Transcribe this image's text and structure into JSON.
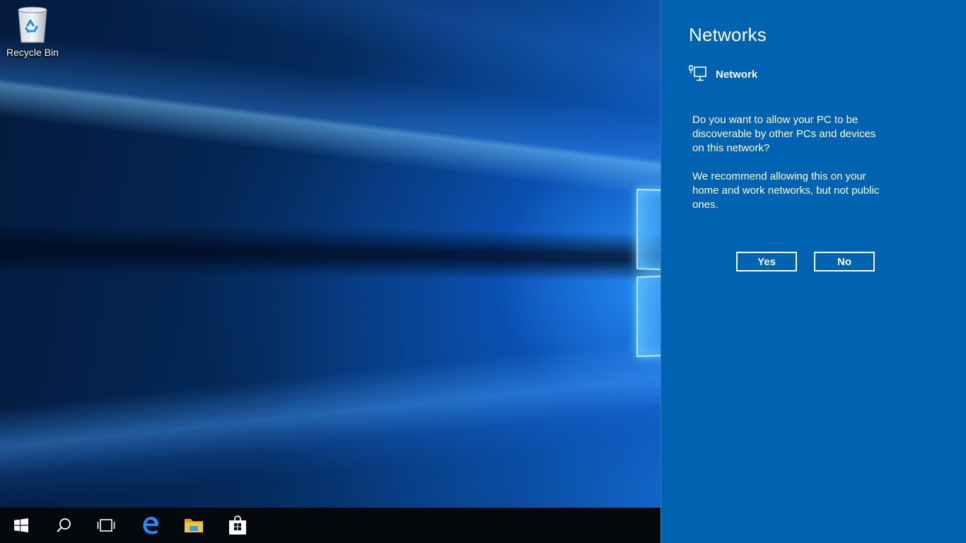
{
  "desktop": {
    "icons": [
      {
        "label": "Recycle Bin",
        "icon": "recycle-bin-icon"
      }
    ]
  },
  "taskbar": {
    "items": [
      {
        "name": "start-button",
        "icon": "windows-logo-icon"
      },
      {
        "name": "search-button",
        "icon": "search-icon"
      },
      {
        "name": "task-view-button",
        "icon": "task-view-icon"
      },
      {
        "name": "edge-button",
        "icon": "edge-browser-icon"
      },
      {
        "name": "file-explorer-button",
        "icon": "folder-icon"
      },
      {
        "name": "store-button",
        "icon": "store-bag-icon"
      }
    ]
  },
  "flyout": {
    "title": "Networks",
    "network_name": "Network",
    "network_icon": "wired-network-icon",
    "prompt": "Do you want to allow your PC to be discoverable by other PCs and devices on this network?",
    "recommendation": "We recommend allowing this on your home and work networks, but not public ones.",
    "yes_label": "Yes",
    "no_label": "No"
  },
  "colors": {
    "flyout_bg": "#0063b1",
    "taskbar_bg": "#05080d",
    "edge_blue": "#1e90ff",
    "folder_yellow": "#f4c542"
  }
}
